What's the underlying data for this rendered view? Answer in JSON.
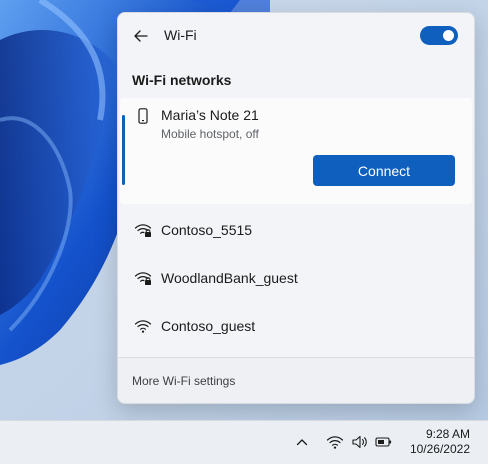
{
  "header": {
    "title": "Wi-Fi",
    "wifi_toggle_on": true
  },
  "section": {
    "title": "Wi-Fi networks"
  },
  "networks": [
    {
      "name": "Maria’s Note 21",
      "status": "Mobile hotspot, off",
      "icon": "phone-icon",
      "expanded": true,
      "action_label": "Connect"
    },
    {
      "name": "Contoso_5515",
      "icon": "wifi-secured-icon"
    },
    {
      "name": "WoodlandBank_guest",
      "icon": "wifi-secured-icon"
    },
    {
      "name": "Contoso_guest",
      "icon": "wifi-icon"
    }
  ],
  "footer": {
    "link": "More Wi-Fi settings"
  },
  "taskbar": {
    "time": "9:28 AM",
    "date": "10/26/2022",
    "tray_icons": [
      "chevron-up-icon",
      "wifi-icon",
      "volume-icon",
      "battery-icon"
    ]
  },
  "colors": {
    "accent": "#0f5fbf",
    "panel": "#f3f4f7"
  }
}
